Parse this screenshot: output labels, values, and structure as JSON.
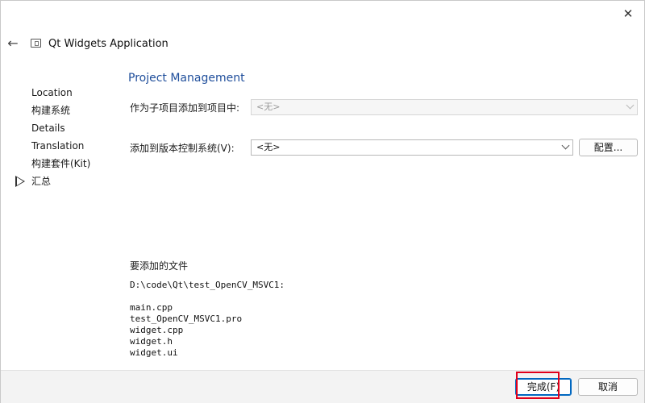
{
  "window": {
    "title": "Qt Widgets Application",
    "close_glyph": "✕",
    "back_glyph": "←"
  },
  "sidebar": {
    "items": [
      {
        "label": "Location"
      },
      {
        "label": "构建系统"
      },
      {
        "label": "Details"
      },
      {
        "label": "Translation"
      },
      {
        "label": "构建套件(Kit)"
      },
      {
        "label": "汇总",
        "current": true
      }
    ]
  },
  "main": {
    "page_title": "Project Management",
    "subproject": {
      "label": "作为子项目添加到项目中:",
      "value": "<无>",
      "enabled": false
    },
    "vcs": {
      "label": "添加到版本控制系统(V):",
      "value": "<无>",
      "config_label": "配置..."
    },
    "files_label": "要添加的文件",
    "files_path": "D:\\code\\Qt\\test_OpenCV_MSVC1:",
    "files": [
      "main.cpp",
      "test_OpenCV_MSVC1.pro",
      "widget.cpp",
      "widget.h",
      "widget.ui"
    ]
  },
  "footer": {
    "finish_label": "完成(F)",
    "cancel_label": "取消"
  },
  "colors": {
    "accent": "#0067c0",
    "page_title": "#1f4e9b",
    "highlight": "#e0001b"
  }
}
